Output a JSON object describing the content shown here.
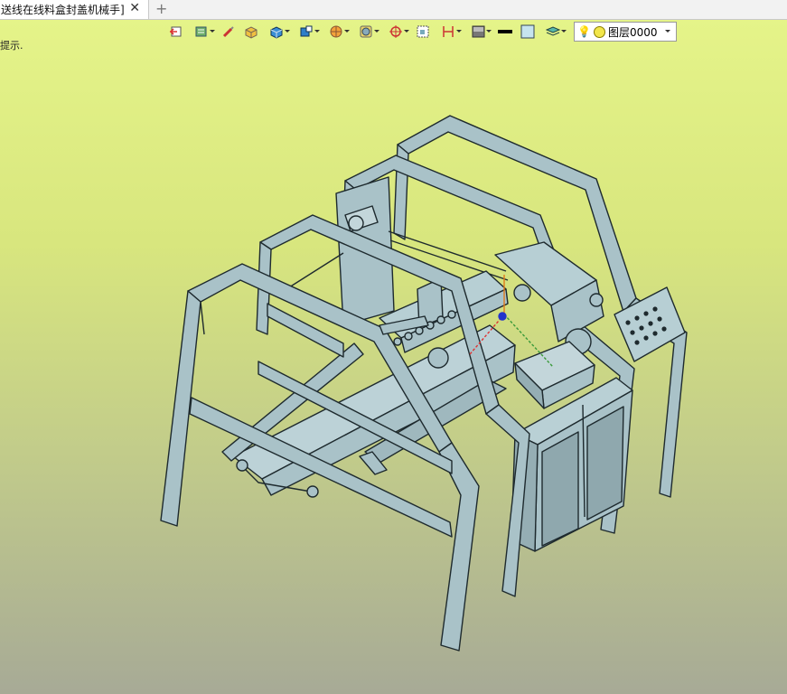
{
  "tab": {
    "title": "送线在线料盒封盖机械手]",
    "close_glyph": "✕",
    "new_glyph": "+"
  },
  "toolbar": {
    "buttons": [
      {
        "name": "exit-sketch-icon"
      },
      {
        "name": "layer-manager-icon",
        "dropdown": true
      },
      {
        "name": "brush-icon"
      },
      {
        "name": "render-icon"
      },
      {
        "name": "solid-display-icon",
        "dropdown": true
      },
      {
        "name": "view-orientation-icon",
        "dropdown": true
      },
      {
        "name": "section-view-icon",
        "dropdown": true
      },
      {
        "name": "shading-icon",
        "dropdown": true
      },
      {
        "name": "snap-icon",
        "dropdown": true
      },
      {
        "name": "frame-select-icon"
      },
      {
        "name": "dimension-icon",
        "dropdown": true
      },
      {
        "name": "background-icon",
        "dropdown": true
      },
      {
        "name": "line-width-icon"
      },
      {
        "name": "color-swatch-icon"
      },
      {
        "name": "layer-stack-icon",
        "dropdown": true
      }
    ],
    "layer_select": {
      "value": "图层0000"
    }
  },
  "hint": "提示.",
  "colors": {
    "part_fill": "#a9c2c8",
    "part_stroke": "#1e2a2e",
    "bg_top": "#e6f58a",
    "bg_bottom": "#a7aa96"
  }
}
